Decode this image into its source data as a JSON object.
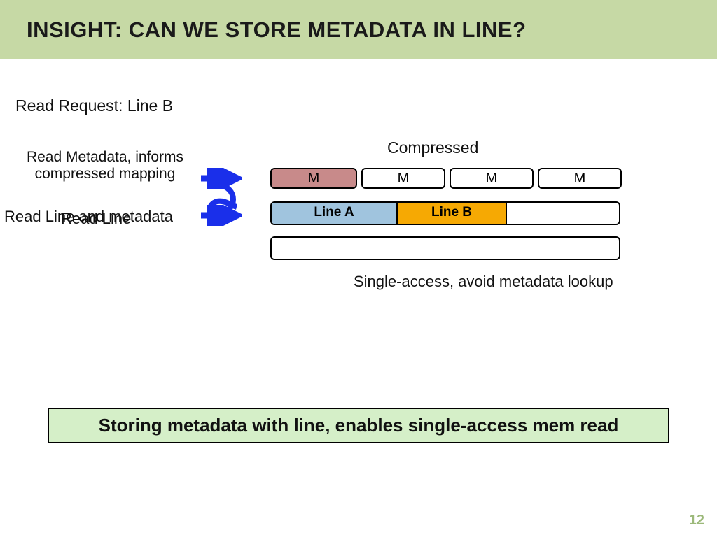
{
  "title": "INSIGHT: CAN WE STORE METADATA IN LINE?",
  "read_request": "Read Request: Line B",
  "step1": "Read Metadata, informs compressed mapping",
  "step2a": "Read Line and metadata",
  "step2b": "Read Line",
  "compressed_label": "Compressed",
  "single_access_label": "Single-access, avoid metadata lookup",
  "meta_row": {
    "m0": "M",
    "m1": "M",
    "m2": "M",
    "m3": "M"
  },
  "lines": {
    "a": "Line A",
    "b": "Line B"
  },
  "conclusion": "Storing metadata with line, enables single-access mem read",
  "page": "12"
}
